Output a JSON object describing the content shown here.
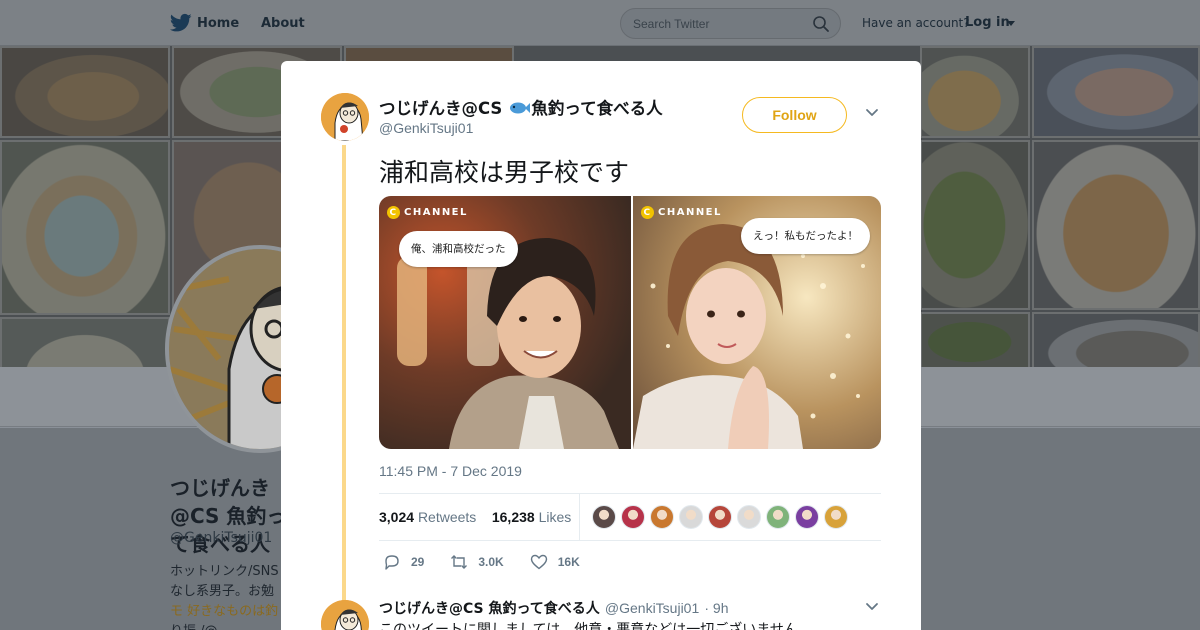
{
  "nav": {
    "home_label": "Home",
    "about_label": "About",
    "search_placeholder": "Search Twitter",
    "have_account_label": "Have an account?",
    "login_label": "Log in"
  },
  "background_profile": {
    "name": "つじげんき@CS 魚釣って食べる人",
    "handle": "@GenkiTsuji01",
    "bio_lines": [
      "ホットリンク/SNS",
      "なし系男子。お勉",
      "モ 好きなものは釣",
      "り振 /@"
    ]
  },
  "tweet": {
    "display_name_part1": "つじげんき@CS",
    "display_name_part2": "魚釣って食べる人",
    "handle": "@GenkiTsuji01",
    "follow_label": "Follow",
    "text": "浦和高校は男子校です",
    "media": {
      "left": {
        "logo_text": "CHANNEL",
        "bubble_text": "俺、浦和高校だった"
      },
      "right": {
        "logo_text": "CHANNEL",
        "bubble_text": "えっ！私もだったよ！"
      }
    },
    "timestamp": "11:45 PM - 7 Dec 2019",
    "stats": {
      "retweets_count": "3,024",
      "retweets_label": "Retweets",
      "likes_count": "16,238",
      "likes_label": "Likes"
    },
    "liker_avatar_colors": [
      "#5a4a48",
      "#b7334a",
      "#c9782f",
      "#d9d9d9",
      "#b6463a",
      "#dadada",
      "#7fb37a",
      "#7a3fa0",
      "#d8a23a"
    ],
    "actions": {
      "reply_count": "29",
      "retweet_count": "3.0K",
      "like_count": "16K"
    }
  },
  "reply": {
    "name": "つじげんき@CS 魚釣って食べる人",
    "handle": "@GenkiTsuji01",
    "time": "· 9h",
    "text": "このツイートに関しましては、他意・悪意などは一切ございません"
  },
  "colors": {
    "accent": "#f5b920",
    "thread_line": "#fbd88a"
  }
}
